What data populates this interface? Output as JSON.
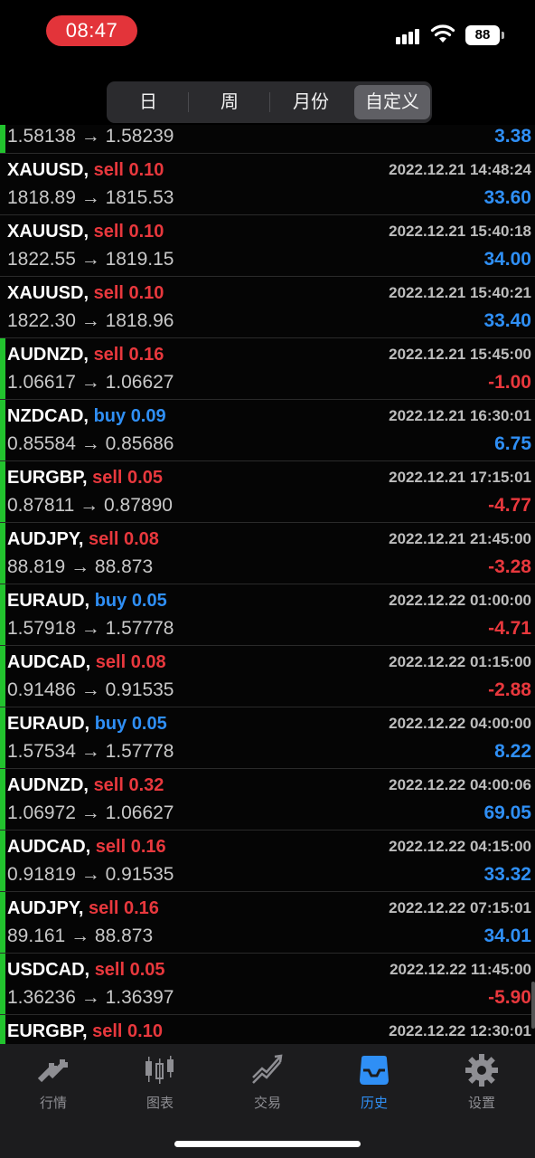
{
  "status_bar": {
    "time": "08:47",
    "battery": "88"
  },
  "segments": [
    {
      "label": "日",
      "active": false
    },
    {
      "label": "周",
      "active": false
    },
    {
      "label": "月份",
      "active": false
    },
    {
      "label": "自定义",
      "active": true
    }
  ],
  "colors": {
    "sell": "#e8383d",
    "buy": "#2f8ff5",
    "marker": "#22c32e",
    "tab_active": "#2f8ff5"
  },
  "trades": [
    {
      "symbol": "",
      "side": "",
      "volume": "",
      "time": "",
      "prices": "1.58138 → 1.58239",
      "profit": "3.38",
      "sign": "pos",
      "marker": true
    },
    {
      "symbol": "XAUUSD,",
      "side": "sell",
      "volume": "0.10",
      "time": "2022.12.21 14:48:24",
      "prices": "1818.89 → 1815.53",
      "profit": "33.60",
      "sign": "pos",
      "marker": false
    },
    {
      "symbol": "XAUUSD,",
      "side": "sell",
      "volume": "0.10",
      "time": "2022.12.21 15:40:18",
      "prices": "1822.55 → 1819.15",
      "profit": "34.00",
      "sign": "pos",
      "marker": false
    },
    {
      "symbol": "XAUUSD,",
      "side": "sell",
      "volume": "0.10",
      "time": "2022.12.21 15:40:21",
      "prices": "1822.30 → 1818.96",
      "profit": "33.40",
      "sign": "pos",
      "marker": false
    },
    {
      "symbol": "AUDNZD,",
      "side": "sell",
      "volume": "0.16",
      "time": "2022.12.21 15:45:00",
      "prices": "1.06617 → 1.06627",
      "profit": "-1.00",
      "sign": "neg",
      "marker": true
    },
    {
      "symbol": "NZDCAD,",
      "side": "buy",
      "volume": "0.09",
      "time": "2022.12.21 16:30:01",
      "prices": "0.85584 → 0.85686",
      "profit": "6.75",
      "sign": "pos",
      "marker": true
    },
    {
      "symbol": "EURGBP,",
      "side": "sell",
      "volume": "0.05",
      "time": "2022.12.21 17:15:01",
      "prices": "0.87811 → 0.87890",
      "profit": "-4.77",
      "sign": "neg",
      "marker": true
    },
    {
      "symbol": "AUDJPY,",
      "side": "sell",
      "volume": "0.08",
      "time": "2022.12.21 21:45:00",
      "prices": "88.819 → 88.873",
      "profit": "-3.28",
      "sign": "neg",
      "marker": true
    },
    {
      "symbol": "EURAUD,",
      "side": "buy",
      "volume": "0.05",
      "time": "2022.12.22 01:00:00",
      "prices": "1.57918 → 1.57778",
      "profit": "-4.71",
      "sign": "neg",
      "marker": true
    },
    {
      "symbol": "AUDCAD,",
      "side": "sell",
      "volume": "0.08",
      "time": "2022.12.22 01:15:00",
      "prices": "0.91486 → 0.91535",
      "profit": "-2.88",
      "sign": "neg",
      "marker": true
    },
    {
      "symbol": "EURAUD,",
      "side": "buy",
      "volume": "0.05",
      "time": "2022.12.22 04:00:00",
      "prices": "1.57534 → 1.57778",
      "profit": "8.22",
      "sign": "pos",
      "marker": true
    },
    {
      "symbol": "AUDNZD,",
      "side": "sell",
      "volume": "0.32",
      "time": "2022.12.22 04:00:06",
      "prices": "1.06972 → 1.06627",
      "profit": "69.05",
      "sign": "pos",
      "marker": true
    },
    {
      "symbol": "AUDCAD,",
      "side": "sell",
      "volume": "0.16",
      "time": "2022.12.22 04:15:00",
      "prices": "0.91819 → 0.91535",
      "profit": "33.32",
      "sign": "pos",
      "marker": true
    },
    {
      "symbol": "AUDJPY,",
      "side": "sell",
      "volume": "0.16",
      "time": "2022.12.22 07:15:01",
      "prices": "89.161 → 88.873",
      "profit": "34.01",
      "sign": "pos",
      "marker": true
    },
    {
      "symbol": "USDCAD,",
      "side": "sell",
      "volume": "0.05",
      "time": "2022.12.22 11:45:00",
      "prices": "1.36236 → 1.36397",
      "profit": "-5.90",
      "sign": "neg",
      "marker": true
    },
    {
      "symbol": "EURGBP,",
      "side": "sell",
      "volume": "0.10",
      "time": "2022.12.22 12:30:01",
      "prices": "",
      "profit": "",
      "sign": "pos",
      "marker": true
    }
  ],
  "tabs": [
    {
      "label": "行情",
      "icon": "quotes-arrows-icon",
      "active": false
    },
    {
      "label": "图表",
      "icon": "candlestick-chart-icon",
      "active": false
    },
    {
      "label": "交易",
      "icon": "trade-trend-icon",
      "active": false
    },
    {
      "label": "历史",
      "icon": "history-inbox-icon",
      "active": true
    },
    {
      "label": "设置",
      "icon": "gear-icon",
      "active": false
    }
  ]
}
